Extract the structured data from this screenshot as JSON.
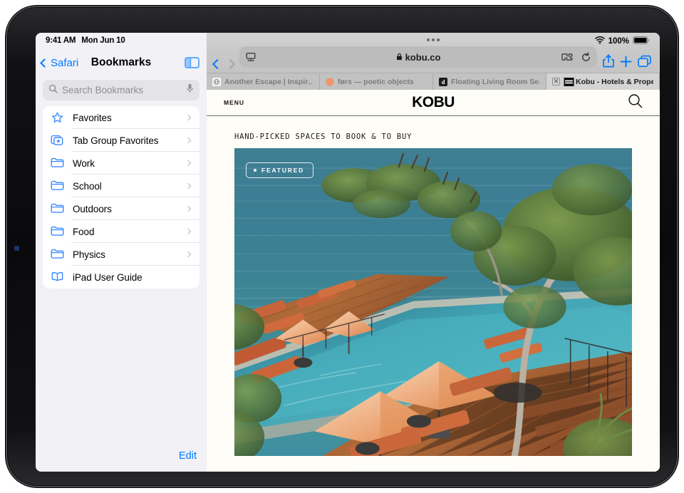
{
  "status_bar": {
    "time": "9:41 AM",
    "date": "Mon Jun 10",
    "battery_percent": "100%",
    "wifi_icon": "wifi-icon",
    "battery_icon": "battery-full-icon"
  },
  "sidebar": {
    "back_label": "Safari",
    "title": "Bookmarks",
    "toggle_icon": "sidebar-toggle-icon",
    "search": {
      "placeholder": "Search Bookmarks",
      "search_icon": "search-icon",
      "mic_icon": "microphone-icon"
    },
    "items": [
      {
        "label": "Favorites",
        "icon": "star-icon",
        "chevron": true
      },
      {
        "label": "Tab Group Favorites",
        "icon": "tab-group-star-icon",
        "chevron": true
      },
      {
        "label": "Work",
        "icon": "folder-icon",
        "chevron": true
      },
      {
        "label": "School",
        "icon": "folder-icon",
        "chevron": true
      },
      {
        "label": "Outdoors",
        "icon": "folder-icon",
        "chevron": true
      },
      {
        "label": "Food",
        "icon": "folder-icon",
        "chevron": true
      },
      {
        "label": "Physics",
        "icon": "folder-icon",
        "chevron": true
      },
      {
        "label": "iPad User Guide",
        "icon": "book-icon",
        "chevron": false
      }
    ],
    "edit_label": "Edit"
  },
  "toolbar": {
    "back_icon": "chevron-left-icon",
    "forward_icon": "chevron-right-icon",
    "reader_icon": "reader-view-icon",
    "lock_icon": "lock-icon",
    "url": "kobu.co",
    "extensions_icon": "puzzle-piece-icon",
    "reload_icon": "reload-icon",
    "share_icon": "share-icon",
    "new_tab_icon": "plus-icon",
    "tab_overview_icon": "tab-overview-icon"
  },
  "tabs": [
    {
      "title": "Another Escape | Inspir…",
      "favicon": "globe-favicon",
      "active": false,
      "close": false
    },
    {
      "title": "førs — poetic objects",
      "favicon": "orange-dot-favicon",
      "active": false,
      "close": false
    },
    {
      "title": "Floating Living Room Se…",
      "favicon": "dezeen-favicon",
      "active": false,
      "close": false
    },
    {
      "title": "Kobu - Hotels & Propert…",
      "favicon": "kobu-favicon",
      "active": true,
      "close": true
    }
  ],
  "site": {
    "menu_label": "MENU",
    "logo": "KOBU",
    "search_icon": "search-icon",
    "tagline": "HAND-PICKED SPACES TO BOOK & TO BUY",
    "hero": {
      "badge_label": "FEATURED",
      "badge_dot": "bullet-dot",
      "alt": "Aerial view of a cliffside resort infinity pool with orange umbrellas and loungers on a wooden deck overlooking the ocean"
    }
  },
  "colors": {
    "accent_blue": "#007aff",
    "page_background": "#fffdf7",
    "sidebar_background": "#f1f1f6",
    "toolbar_background": "#c9c9c9",
    "ocean_teal": "#3a7f95",
    "umbrella_orange": "#e08a5d",
    "deck_wood": "#9c5c33"
  }
}
